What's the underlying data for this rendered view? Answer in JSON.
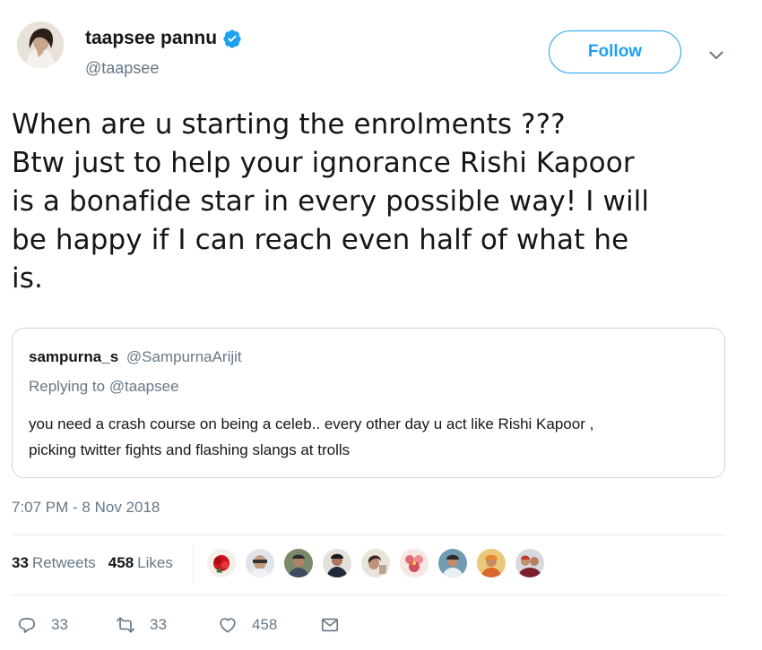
{
  "author": {
    "display_name": "taapsee pannu",
    "handle": "@taapsee",
    "verified_icon": "verified-badge-icon"
  },
  "follow_label": "Follow",
  "tweet_text": [
    "When are u starting the enrolments ???",
    "Btw just to help your ignorance Rishi Kapoor",
    "is a bonafide star in every possible way! I will",
    "be happy if I can reach even half of what he",
    "is."
  ],
  "quoted": {
    "name": "sampurna_s",
    "handle": "@SampurnaArijit",
    "replying_to": "Replying to @taapsee",
    "text_lines": [
      "you need a crash course on being a celeb.. every other day u act like Rishi Kapoor ,",
      "picking twitter fights and flashing slangs at trolls"
    ]
  },
  "timestamp": "7:07 PM - 8 Nov 2018",
  "stats": {
    "retweets_count": "33",
    "retweets_label": "Retweets",
    "likes_count": "458",
    "likes_label": "Likes"
  },
  "actions": {
    "reply_count": "33",
    "retweet_count": "33",
    "like_count": "458"
  },
  "colors": {
    "accent": "#1da1f2",
    "text": "#14171a",
    "secondary_text": "#657786",
    "border": "#ccd6dd",
    "divider": "#e6ecf0"
  }
}
